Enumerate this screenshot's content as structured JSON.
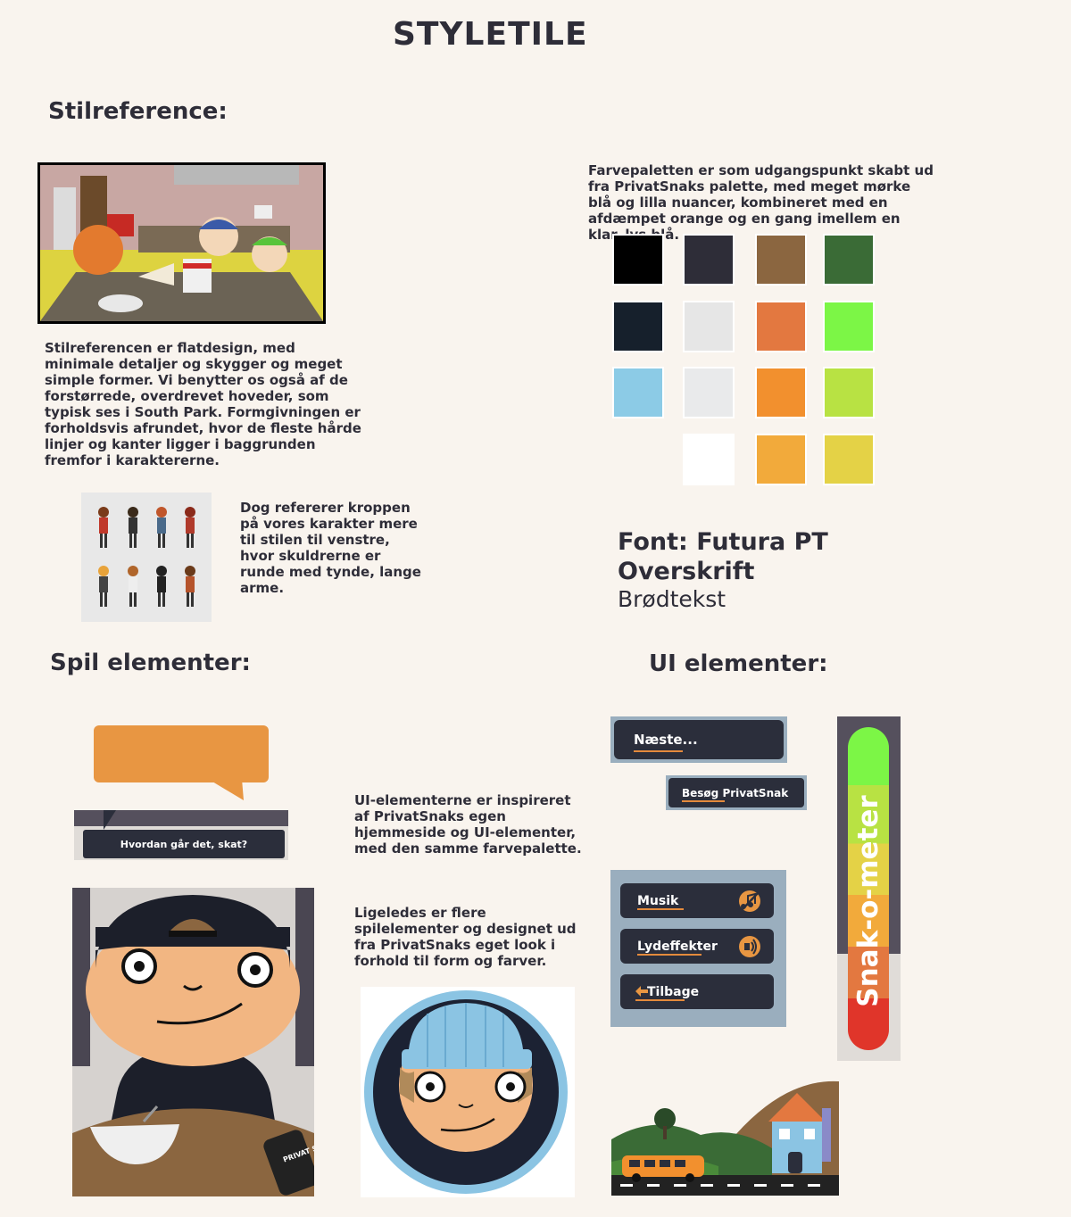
{
  "page": {
    "title": "STYLETILE"
  },
  "stil": {
    "heading": "Stilreference:",
    "para1": "Stilreferencen er flatdesign, med minimale detaljer og skygger og meget simple former. Vi benytter os også af de forstørrede, overdrevet hoveder, som typisk ses i South Park. Formgivningen er forholdsvis afrundet, hvor de fleste hårde linjer og kanter ligger i baggrunden fremfor i karaktererne.",
    "para2": "Dog refererer kroppen på vores karakter mere til stilen til venstre, hvor skuldrerne er runde med tynde, lange arme."
  },
  "palette": {
    "text": "Farvepaletten er som udgangspunkt skabt ud fra PrivatSnaks palette, med meget mørke blå og lilla nuancer, kombineret med en afdæmpet orange og en gang imellem en klar, lys blå.",
    "colors": [
      "#000000",
      "#2e2d38",
      "#8b6640",
      "#3a6b36",
      "#16202c",
      "#e6e6e6",
      "#e37840",
      "#7cf646",
      "#8ccbe6",
      "#e9eaeb",
      "#f2902e",
      "#b8e243",
      "#ffffff",
      "#f2aa3b",
      "#e4d246"
    ]
  },
  "font": {
    "line1": "Font: Futura PT",
    "line2": "Overskrift",
    "line3": "Brødtekst"
  },
  "spil": {
    "heading": "Spil elementer:",
    "dialog_text": "Hvordan går det, skat?",
    "para1": "UI-elementerne er inspireret af PrivatSnaks egen hjemmeside og UI-elementer, med den samme farvepalette.",
    "para2": "Ligeledes er flere spilelementer og designet ud fra PrivatSnaks eget look i forhold til form og farver.",
    "phone_text": "PRIVAT SNAK"
  },
  "ui": {
    "heading": "UI elementer:",
    "next_button": "Næste...",
    "visit_button": "Besøg PrivatSnak",
    "music_button": "Musik",
    "sfx_button": "Lydeffekter",
    "back_button": "Tilbage",
    "meter_label": "Snak-o-meter",
    "icons": [
      "music-off-icon",
      "sound-on-icon",
      "arrow-left-icon"
    ]
  }
}
